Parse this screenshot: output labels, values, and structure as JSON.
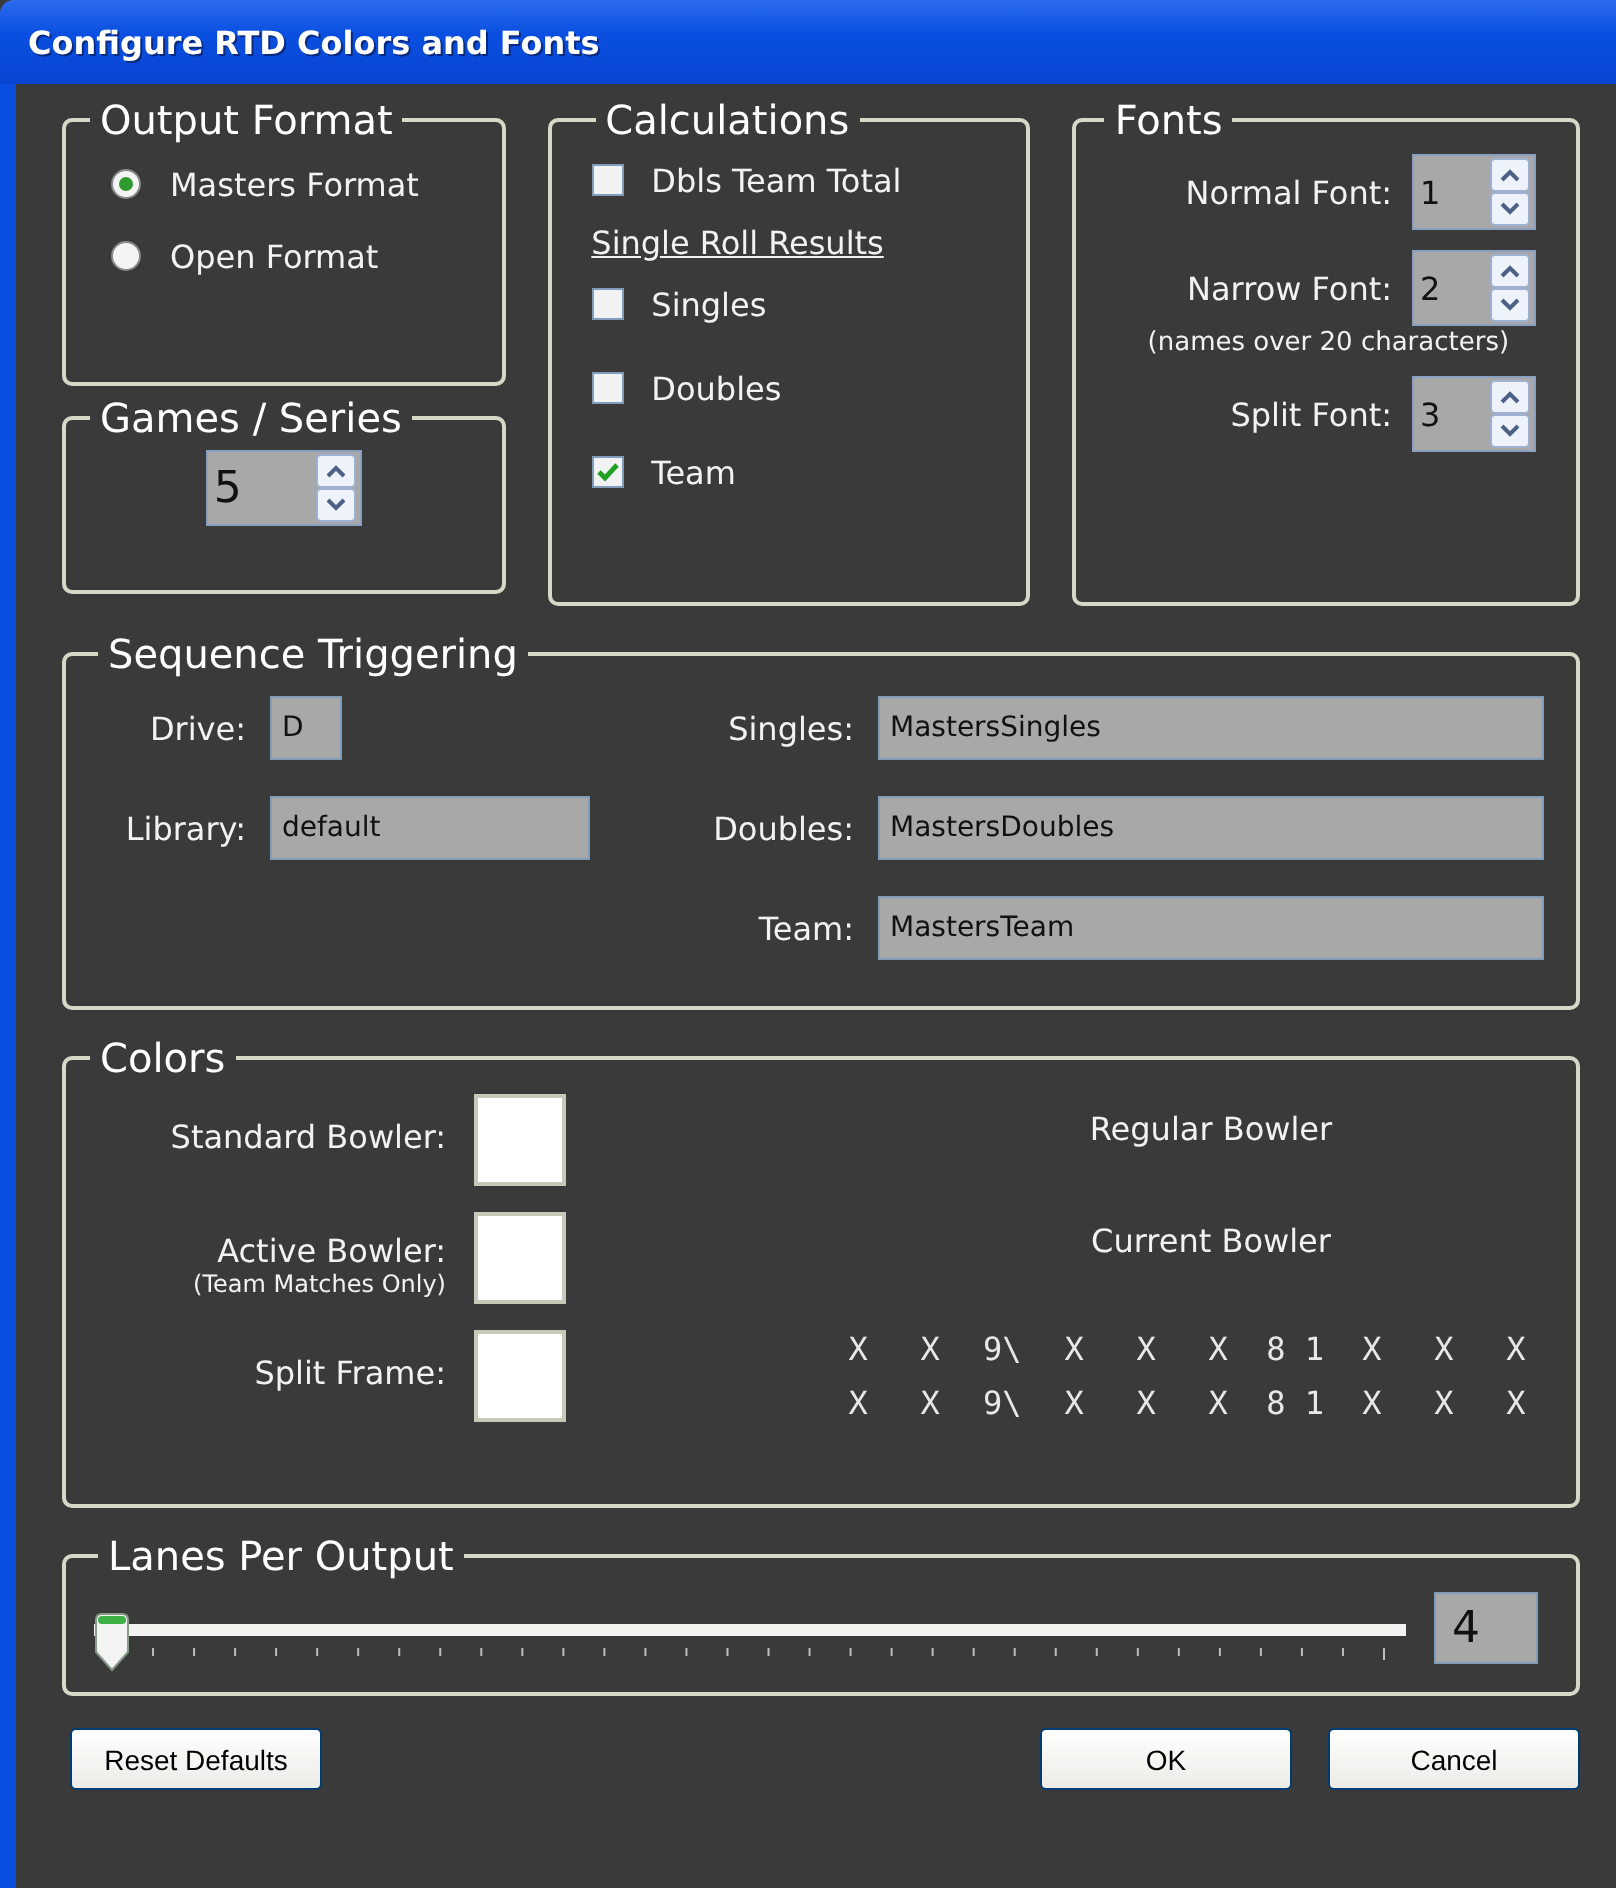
{
  "window": {
    "title": "Configure RTD Colors and Fonts"
  },
  "output_format": {
    "title": "Output Format",
    "options": [
      {
        "label": "Masters Format",
        "selected": true
      },
      {
        "label": "Open Format",
        "selected": false
      }
    ]
  },
  "games_series": {
    "title": "Games / Series",
    "value": "5"
  },
  "calculations": {
    "title": "Calculations",
    "items": [
      {
        "kind": "checkbox",
        "label": "Dbls Team Total",
        "checked": false
      },
      {
        "kind": "heading",
        "label": "Single Roll Results"
      },
      {
        "kind": "checkbox",
        "label": "Singles",
        "checked": false
      },
      {
        "kind": "checkbox",
        "label": "Doubles",
        "checked": false
      },
      {
        "kind": "checkbox",
        "label": "Team",
        "checked": true
      }
    ]
  },
  "fonts": {
    "title": "Fonts",
    "rows": [
      {
        "kind": "spin",
        "label": "Normal Font:",
        "value": "1"
      },
      {
        "kind": "spin",
        "label": "Narrow Font:",
        "value": "2"
      },
      {
        "kind": "note",
        "label": "(names over 20 characters)"
      },
      {
        "kind": "spin",
        "label": "Split Font:",
        "value": "3"
      }
    ]
  },
  "sequence_triggering": {
    "title": "Sequence Triggering",
    "left": [
      {
        "label": "Drive:",
        "value": "D"
      },
      {
        "label": "Library:",
        "value": "default"
      }
    ],
    "right": [
      {
        "label": "Singles:",
        "value": "MastersSingles"
      },
      {
        "label": "Doubles:",
        "value": "MastersDoubles"
      },
      {
        "label": "Team:",
        "value": "MastersTeam"
      }
    ]
  },
  "colors": {
    "title": "Colors",
    "swatches": [
      {
        "label": "Standard Bowler:",
        "color": "#ffffff"
      },
      {
        "label": "Active Bowler:",
        "note": "(Team Matches Only)",
        "color": "#ffffff"
      },
      {
        "label": "Split Frame:",
        "color": "#ffffff"
      }
    ],
    "previews": [
      "Regular Bowler",
      "Current Bowler"
    ],
    "score_rows": [
      {
        "frames": [
          "X",
          "X",
          "9\\",
          "X",
          "X",
          "X",
          "8 1",
          "X",
          "X",
          "X"
        ]
      },
      {
        "frames": [
          "X",
          "X",
          "9\\",
          "X",
          "X",
          "X",
          "8 1",
          "X",
          "X",
          "X"
        ]
      }
    ]
  },
  "lanes_per_output": {
    "title": "Lanes Per Output",
    "level": 0,
    "value": "4"
  },
  "buttons": [
    {
      "label": "Reset Defaults"
    },
    {
      "label": "OK"
    },
    {
      "label": "Cancel"
    }
  ]
}
